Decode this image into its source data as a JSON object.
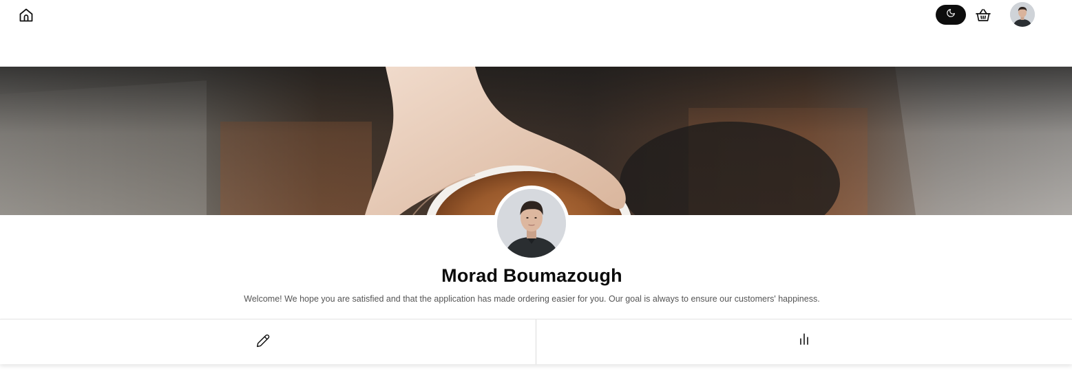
{
  "navbar": {
    "home_icon": "home-icon",
    "theme_icon": "moon-icon",
    "cart_icon": "basket-icon",
    "avatar_icon": "user-avatar"
  },
  "profile": {
    "name": "Morad Boumazough",
    "bio": "Welcome! We hope you are satisfied and that the application has made ordering easier for you. Our goal is always to ensure our customers' happiness."
  },
  "tabs": [
    {
      "icon": "pencil-icon"
    },
    {
      "icon": "bar-chart-icon"
    }
  ],
  "colors": {
    "toggle_bg": "#0d0d0d",
    "text_primary": "#0b0b0b",
    "text_secondary": "#555555",
    "divider": "#dcdcdc"
  }
}
